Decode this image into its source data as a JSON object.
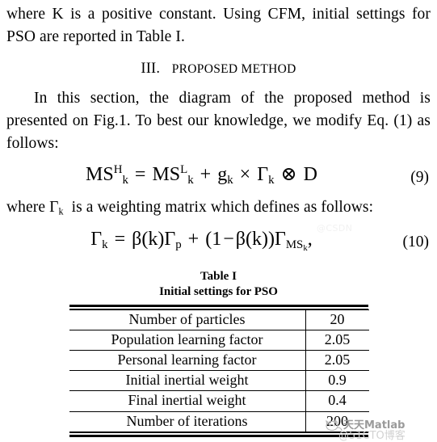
{
  "document": {
    "paragraph_1": "where K is a positive constant. Using CFM, initial settings for PSO are reported in Table I.",
    "section_number": "III.",
    "section_title": "PROPOSED METHOD",
    "paragraph_2": "In this section, the diagram of the proposed method is presented on Fig.1. To best our knowledge, we modify Eq. (1) as follows:",
    "paragraph_3": "where Γk is a weighting matrix which defines as follows:"
  },
  "equations": [
    {
      "id": "eq-9",
      "number": "(9)",
      "latex": "MS_k^H = MS_k^L + g_k \\times \\Gamma_k \\otimes D",
      "parts": {
        "lhs_base": "MS",
        "lhs_sup": "H",
        "lhs_sub": "k",
        "eq_sign": "=",
        "rhs_base": "MS",
        "rhs_sup": "L",
        "rhs_sub": "k",
        "plus": "+",
        "g": "g",
        "g_sub": "k",
        "times": "×",
        "gamma": "Γ",
        "gamma_sub": "k",
        "otimes": "⊗",
        "d": "D"
      }
    },
    {
      "id": "eq-10",
      "number": "(10)",
      "latex": "\\Gamma_k = \\beta(k)\\Gamma_p + (1-\\beta(k))\\Gamma_{MS_k},",
      "parts": {
        "gamma": "Γ",
        "gamma_sub": "k",
        "eq_sign": "=",
        "beta_k": "β(k)",
        "gamma_p": "Γ",
        "gamma_p_sub": "p",
        "plus": "+",
        "open": "(1",
        "minus": "−",
        "beta_k2": "β(k))",
        "gamma_ms": "Γ",
        "gamma_ms_sub": "MS",
        "gamma_ms_subsub": "k",
        "comma": ","
      }
    }
  ],
  "table": {
    "caption_line1": "Table I",
    "caption_line2": "Initial settings for PSO",
    "rows": [
      {
        "label": "Number of particles",
        "value": "20"
      },
      {
        "label": "Population learning factor",
        "value": "2.05"
      },
      {
        "label": "Personal learning factor",
        "value": "2.05"
      },
      {
        "label": "Initial inertial weight",
        "value": "0.9"
      },
      {
        "label": "Final inertial weight",
        "value": "0.4"
      },
      {
        "label": "Number of iterations",
        "value": "200"
      }
    ]
  },
  "watermarks": {
    "middle": "@CSDN",
    "bottom_name": "天天Matlab",
    "bottom_site": "@51CTO博客"
  },
  "colors": {
    "text": "#000000",
    "background": "#ffffff",
    "watermark_name": "#9a9a9a",
    "watermark_site": "#d2d2d2",
    "watermark_faint": "#f2f2f2"
  }
}
